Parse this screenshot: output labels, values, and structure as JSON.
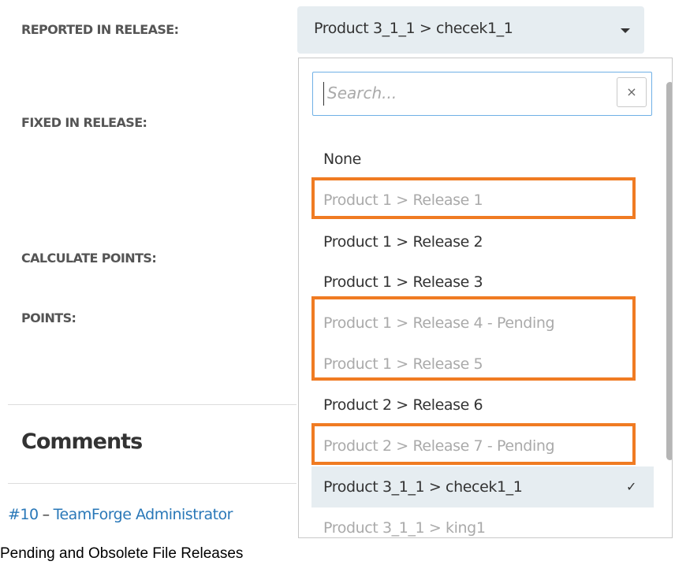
{
  "form": {
    "labels": {
      "reported_in_release": "REPORTED IN RELEASE:",
      "fixed_in_release": "FIXED IN RELEASE:",
      "calculate_points": "CALCULATE POINTS:",
      "points": "POINTS:"
    }
  },
  "release_select": {
    "value": "Product 3_1_1 > checek1_1",
    "caret_icon": "chevron-down-icon"
  },
  "dropdown": {
    "search": {
      "placeholder": "Search...",
      "value": "",
      "clear_label": "×"
    },
    "options": [
      {
        "label": "None",
        "state": "normal"
      },
      {
        "label": "Product 1 > Release 1",
        "state": "disabled"
      },
      {
        "label": "Product 1 > Release 2",
        "state": "normal"
      },
      {
        "label": "Product 1 > Release 3",
        "state": "normal"
      },
      {
        "label": "Product 1 > Release 4 - Pending",
        "state": "disabled"
      },
      {
        "label": "Product 1 > Release 5",
        "state": "disabled"
      },
      {
        "label": "Product 2 > Release 6",
        "state": "normal"
      },
      {
        "label": "Product 2 > Release 7 - Pending",
        "state": "disabled"
      },
      {
        "label": "Product 3_1_1 > checek1_1",
        "state": "selected"
      },
      {
        "label": "Product 3_1_1 > king1",
        "state": "disabled"
      }
    ],
    "check_mark": "✓"
  },
  "comments": {
    "heading": "Comments",
    "entry": {
      "number": "#10",
      "separator": "–",
      "author": "TeamForge Administrator"
    }
  },
  "caption": "Pending and Obsolete File Releases",
  "colors": {
    "highlight": "#f07b22",
    "select_background": "#e6edf1",
    "link": "#2a78b8",
    "disabled_text": "#aaaaaa",
    "search_focus_border": "#6fb0e6"
  }
}
